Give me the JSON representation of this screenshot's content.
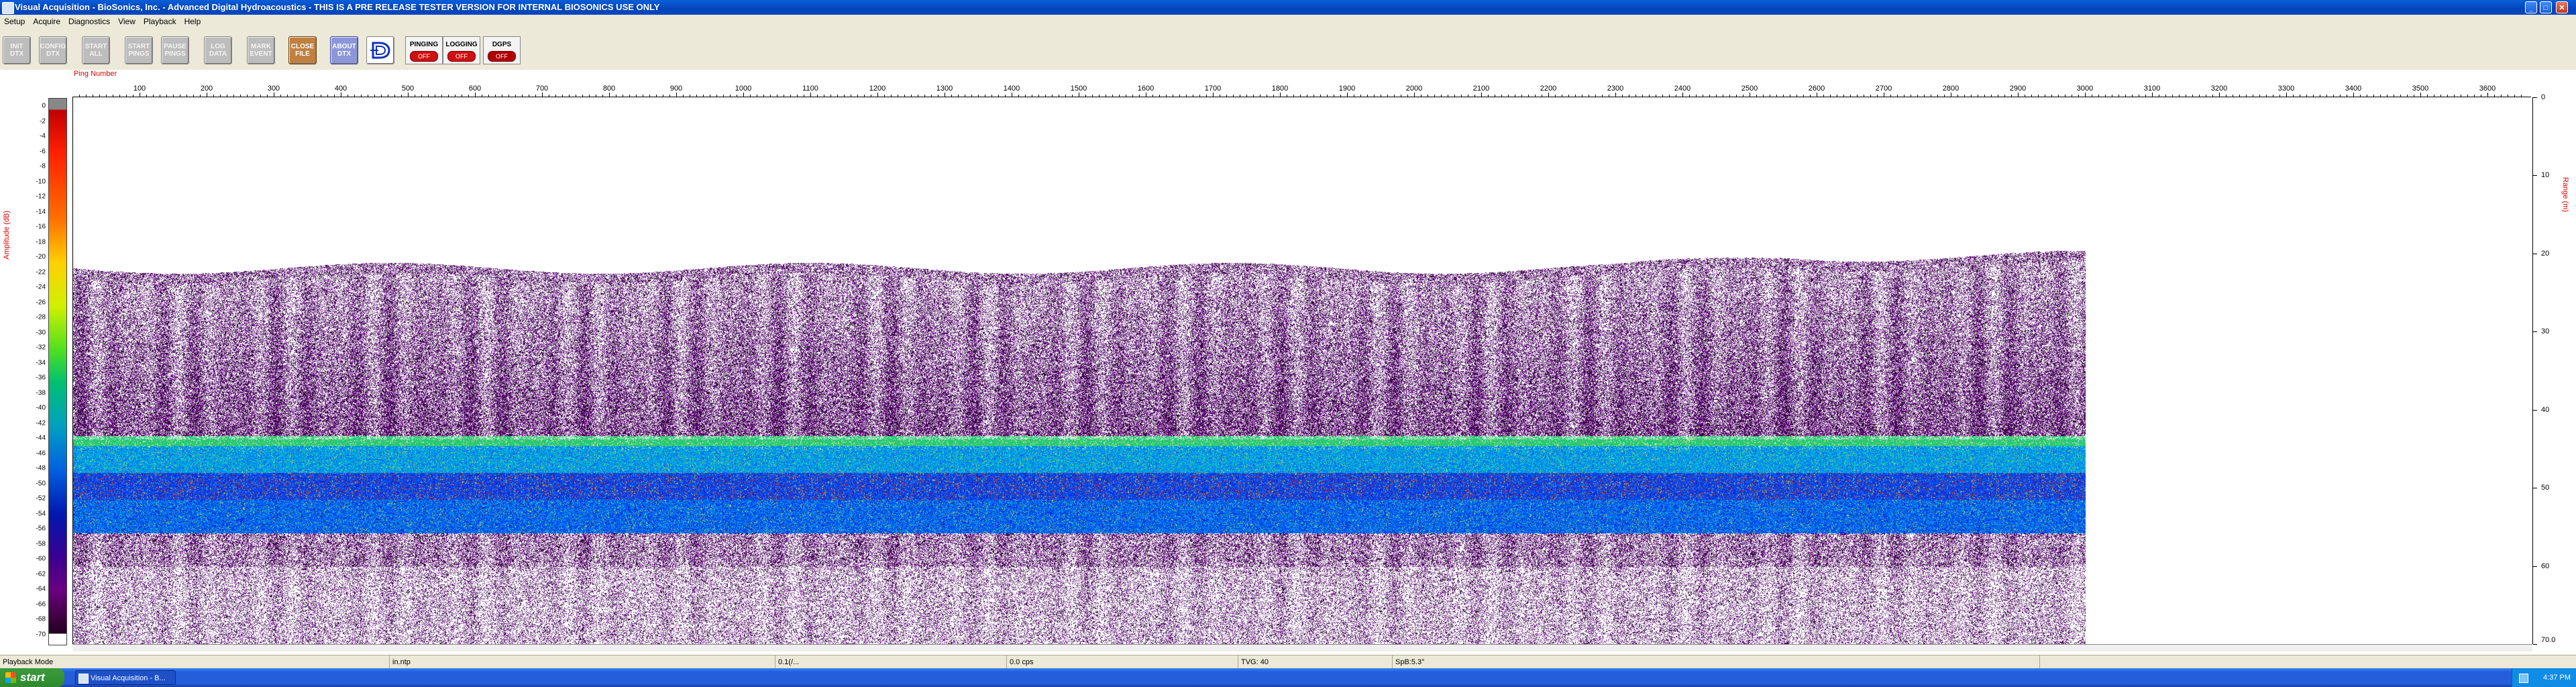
{
  "window": {
    "title": "Visual Acquisition  -  BioSonics, Inc.  -  Advanced Digital Hydroacoustics  -  THIS IS A PRE RELEASE TESTER VERSION FOR INTERNAL BIOSONICS USE ONLY",
    "minimize": "_",
    "maximize": "□",
    "close": "✕"
  },
  "menu": [
    "Setup",
    "Acquire",
    "Diagnostics",
    "View",
    "Playback",
    "Help"
  ],
  "toolbar": {
    "buttons": [
      {
        "label": "INIT\nDTX"
      },
      {
        "label": "CONFIG\nDTX"
      },
      {
        "label": "START\nALL"
      },
      {
        "label": "START\nPINGS"
      },
      {
        "label": "PAUSE\nPINGS"
      },
      {
        "label": "LOG\nDATA"
      },
      {
        "label": "MARK\nEVENT"
      },
      {
        "label": "CLOSE\nFILE"
      },
      {
        "label": "ABOUT\nDTX"
      }
    ],
    "status": [
      {
        "label": "PINGING",
        "state": "OFF"
      },
      {
        "label": "LOGGING",
        "state": "OFF"
      },
      {
        "label": "DGPS",
        "state": "OFF"
      }
    ]
  },
  "plot": {
    "ping_axis_title": "Ping Number",
    "amplitude_axis_title": "Amplitude (dB)",
    "range_axis_title": "Range (m)",
    "ping_ticks": [
      "100",
      "200",
      "300",
      "400",
      "500",
      "600",
      "700",
      "800",
      "900",
      "1000",
      "1100",
      "1200",
      "1300",
      "1400",
      "1500",
      "1600",
      "1700",
      "1800",
      "1900",
      "2000",
      "2100",
      "2200",
      "2300",
      "2400",
      "2500",
      "2600",
      "2700",
      "2800",
      "2900",
      "3000",
      "3100",
      "3200",
      "3300",
      "3400",
      "3500",
      "3600"
    ],
    "amplitude_ticks": [
      "0",
      "-2",
      "-4",
      "-6",
      "-8",
      "-10",
      "-12",
      "-14",
      "-16",
      "-18",
      "-20",
      "-22",
      "-24",
      "-26",
      "-28",
      "-30",
      "-32",
      "-34",
      "-36",
      "-38",
      "-40",
      "-42",
      "-44",
      "-46",
      "-48",
      "-50",
      "-52",
      "-54",
      "-56",
      "-58",
      "-60",
      "-62",
      "-64",
      "-66",
      "-68",
      "-70"
    ],
    "range_ticks": [
      "0",
      "10",
      "20",
      "30",
      "40",
      "50",
      "60",
      "70.0"
    ]
  },
  "statusbar": {
    "mode": "Playback Mode",
    "rate": "in.ntp",
    "pos": "0.1(/...",
    "cps": "0.0 cps",
    "tvg": "TVG: 40",
    "spb": "SpB:5.3°"
  },
  "taskbar": {
    "start": "start",
    "item": "Visual Acquisition - B...",
    "clock": "4:37 PM"
  }
}
